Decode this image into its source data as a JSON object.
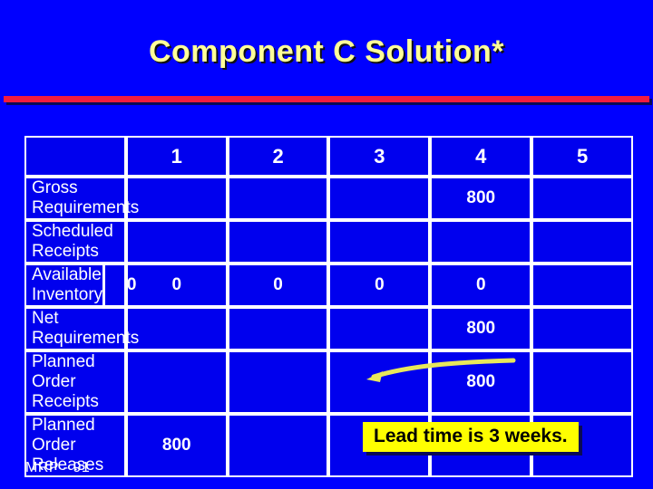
{
  "slide": {
    "title": "Component C Solution*",
    "footer": "MRP - 91",
    "accent_rule_color": "#f21b3f",
    "background_color": "#0000ff",
    "title_color": "#ffff99"
  },
  "table": {
    "corner_label": "",
    "periods": [
      "1",
      "2",
      "3",
      "4",
      "5"
    ],
    "rows": [
      {
        "label": "Gross Requirements",
        "on_hand": null,
        "cells": [
          "",
          "",
          "",
          "800",
          ""
        ]
      },
      {
        "label": "Scheduled Receipts",
        "on_hand": null,
        "cells": [
          "",
          "",
          "",
          "",
          ""
        ]
      },
      {
        "label": "Available Inventory",
        "on_hand": "0",
        "cells": [
          "0",
          "0",
          "0",
          "0",
          ""
        ]
      },
      {
        "label": "Net Requirements",
        "on_hand": null,
        "cells": [
          "",
          "",
          "",
          "800",
          ""
        ]
      },
      {
        "label": "Planned Order Receipts",
        "on_hand": null,
        "cells": [
          "",
          "",
          "",
          "800",
          ""
        ]
      },
      {
        "label": "Planned Order Releases",
        "on_hand": null,
        "cells": [
          "800",
          "",
          "",
          "",
          ""
        ]
      }
    ]
  },
  "annotation": {
    "callout_text": "Lead time is 3 weeks.",
    "callout_bg": "#ffff00",
    "callout_fg": "#000000",
    "arrow_color": "#e8e85a"
  }
}
